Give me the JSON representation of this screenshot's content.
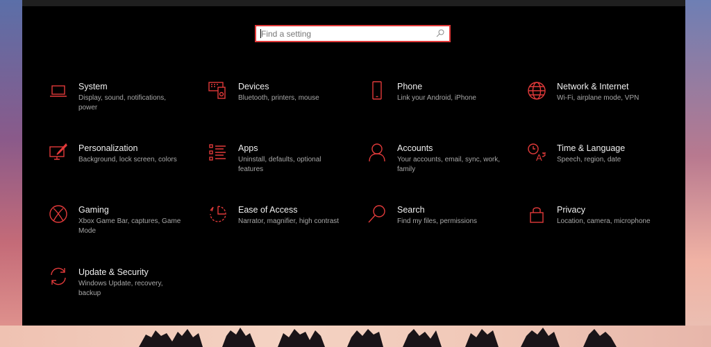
{
  "search": {
    "placeholder": "Find a setting"
  },
  "accent_color": "#e23a3a",
  "tiles": [
    {
      "title": "System",
      "desc": "Display, sound, notifications, power",
      "icon": "laptop-icon"
    },
    {
      "title": "Devices",
      "desc": "Bluetooth, printers, mouse",
      "icon": "devices-icon"
    },
    {
      "title": "Phone",
      "desc": "Link your Android, iPhone",
      "icon": "phone-icon"
    },
    {
      "title": "Network & Internet",
      "desc": "Wi-Fi, airplane mode, VPN",
      "icon": "globe-icon"
    },
    {
      "title": "Personalization",
      "desc": "Background, lock screen, colors",
      "icon": "paint-brush-icon"
    },
    {
      "title": "Apps",
      "desc": "Uninstall, defaults, optional features",
      "icon": "apps-list-icon"
    },
    {
      "title": "Accounts",
      "desc": "Your accounts, email, sync, work, family",
      "icon": "person-icon"
    },
    {
      "title": "Time & Language",
      "desc": "Speech, region, date",
      "icon": "time-language-icon"
    },
    {
      "title": "Gaming",
      "desc": "Xbox Game Bar, captures, Game Mode",
      "icon": "xbox-icon"
    },
    {
      "title": "Ease of Access",
      "desc": "Narrator, magnifier, high contrast",
      "icon": "ease-of-access-icon"
    },
    {
      "title": "Search",
      "desc": "Find my files, permissions",
      "icon": "search-magnifier-icon"
    },
    {
      "title": "Privacy",
      "desc": "Location, camera, microphone",
      "icon": "lock-icon"
    },
    {
      "title": "Update & Security",
      "desc": "Windows Update, recovery, backup",
      "icon": "refresh-icon"
    }
  ]
}
